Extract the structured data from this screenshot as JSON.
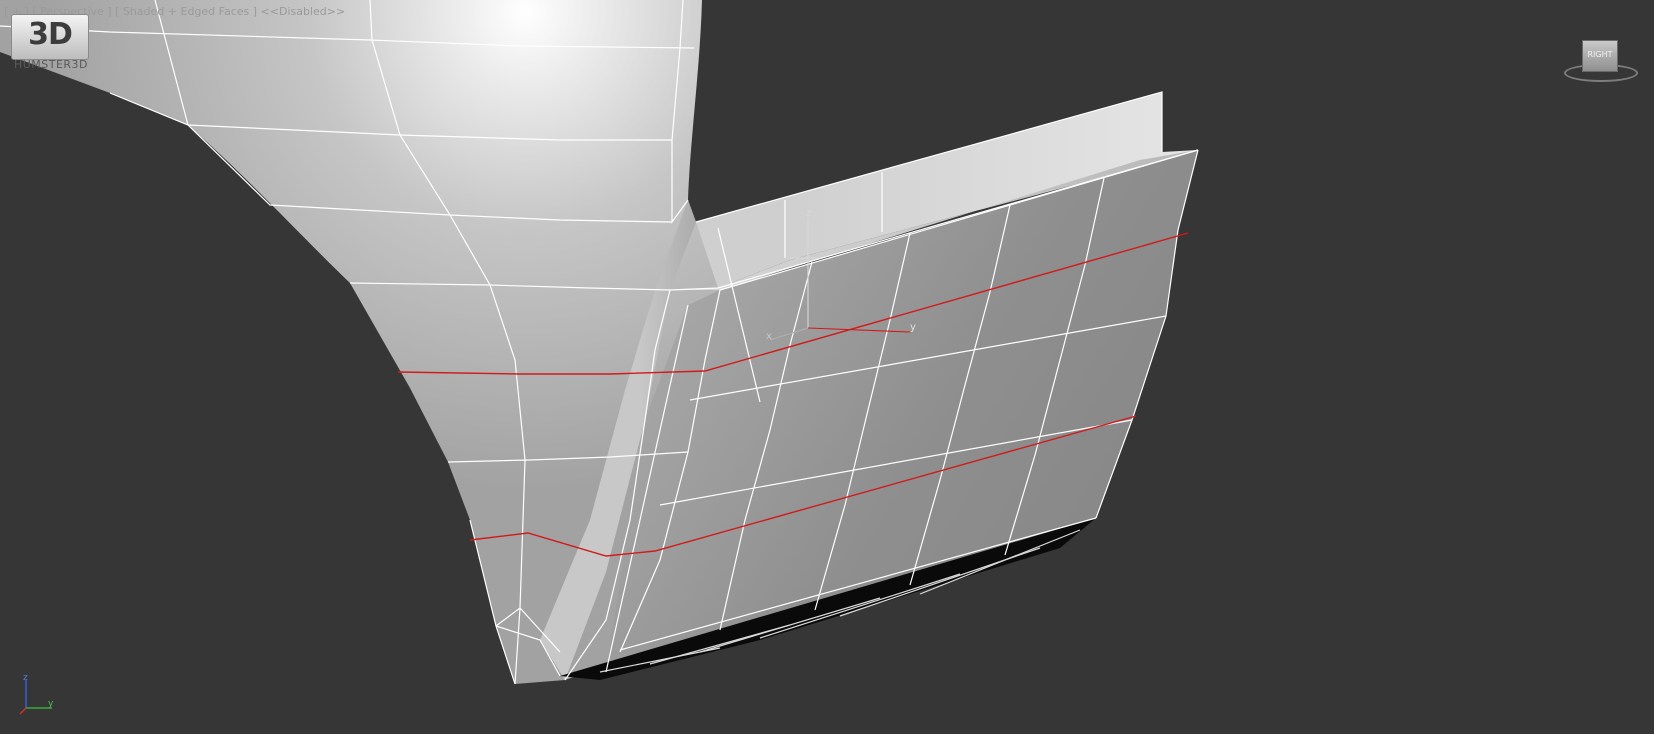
{
  "viewport": {
    "label": "[ + ] [ Perspective ] [ Shaded + Edged Faces ] <<Disabled>>"
  },
  "watermark": {
    "logo_text": "3D",
    "brand": "HUMSTER3D"
  },
  "viewcube": {
    "face_label": "RIGHT"
  },
  "gizmo": {
    "x_label": "x",
    "y_label": "y",
    "z_label": "z"
  },
  "world_axes": {
    "y_label": "y",
    "z_label": "z"
  },
  "colors": {
    "background": "#363636",
    "edge": "#ffffff",
    "selected_edge": "#d11a1a",
    "axis_x": "#c83232",
    "axis_y": "#3aa83a",
    "axis_z": "#3a5cd8"
  }
}
